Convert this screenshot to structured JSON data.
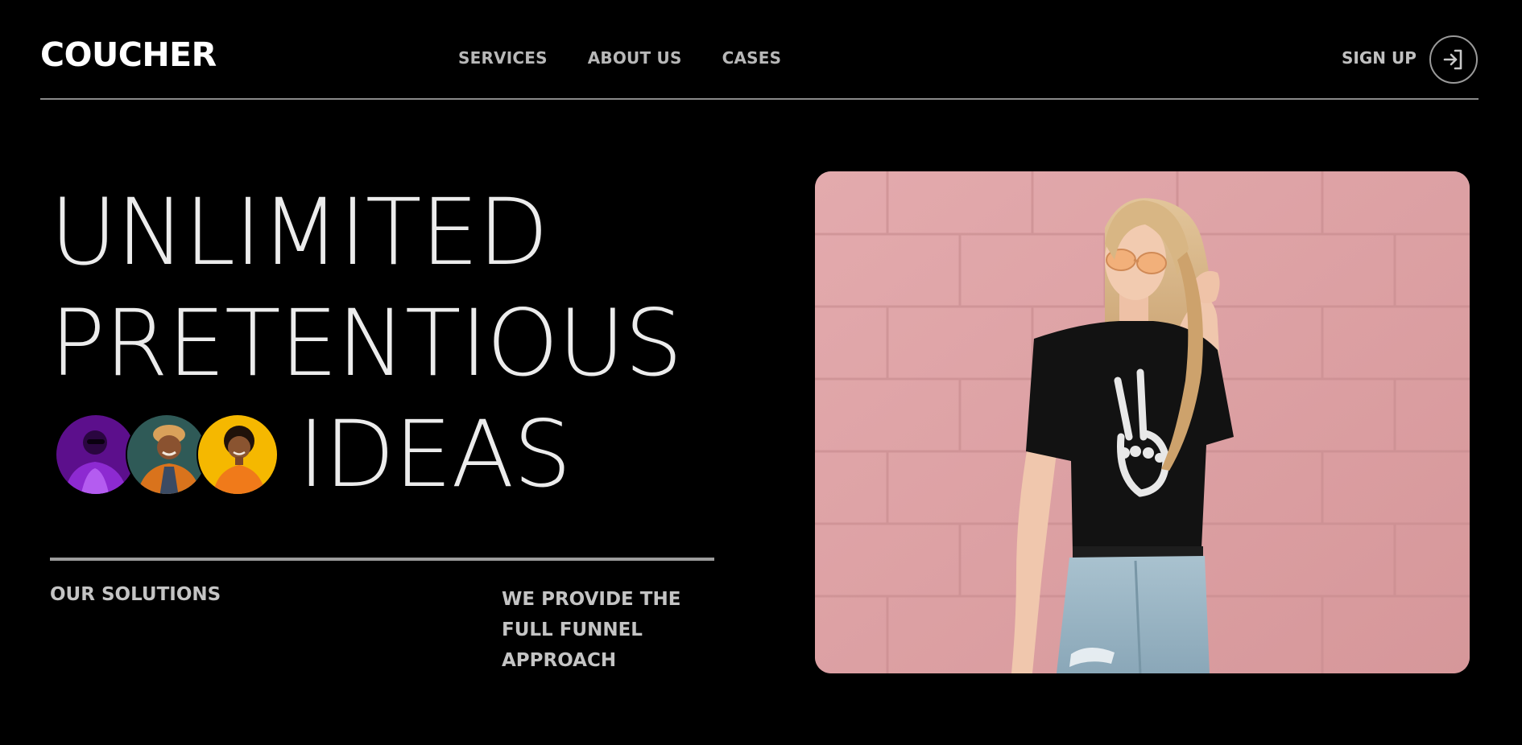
{
  "header": {
    "logo": "COUCHER",
    "nav": [
      "SERVICES",
      "ABOUT US",
      "CASES"
    ],
    "signup_label": "SIGN UP",
    "signin_icon": "sign-in-arrow-icon"
  },
  "hero": {
    "headline": [
      "UNLIMITED",
      "PRETENTIOUS",
      "IDEAS"
    ],
    "avatars": [
      {
        "name": "avatar-purple",
        "bg": "#5c0f8c"
      },
      {
        "name": "avatar-teal",
        "bg": "#2f5a57"
      },
      {
        "name": "avatar-yellow",
        "bg": "#f5b800"
      }
    ],
    "solutions_label": "OUR SOLUTIONS",
    "funnel_text": "WE PROVIDE THE FULL FUNNEL APPROACH"
  },
  "photo": {
    "subject": "woman-leaning-on-pink-brick-wall",
    "wall_color": "#dda1a4"
  },
  "colors": {
    "background": "#000000",
    "text": "#ececec",
    "muted": "#b8b8b8",
    "rule": "#8a8a8a"
  }
}
